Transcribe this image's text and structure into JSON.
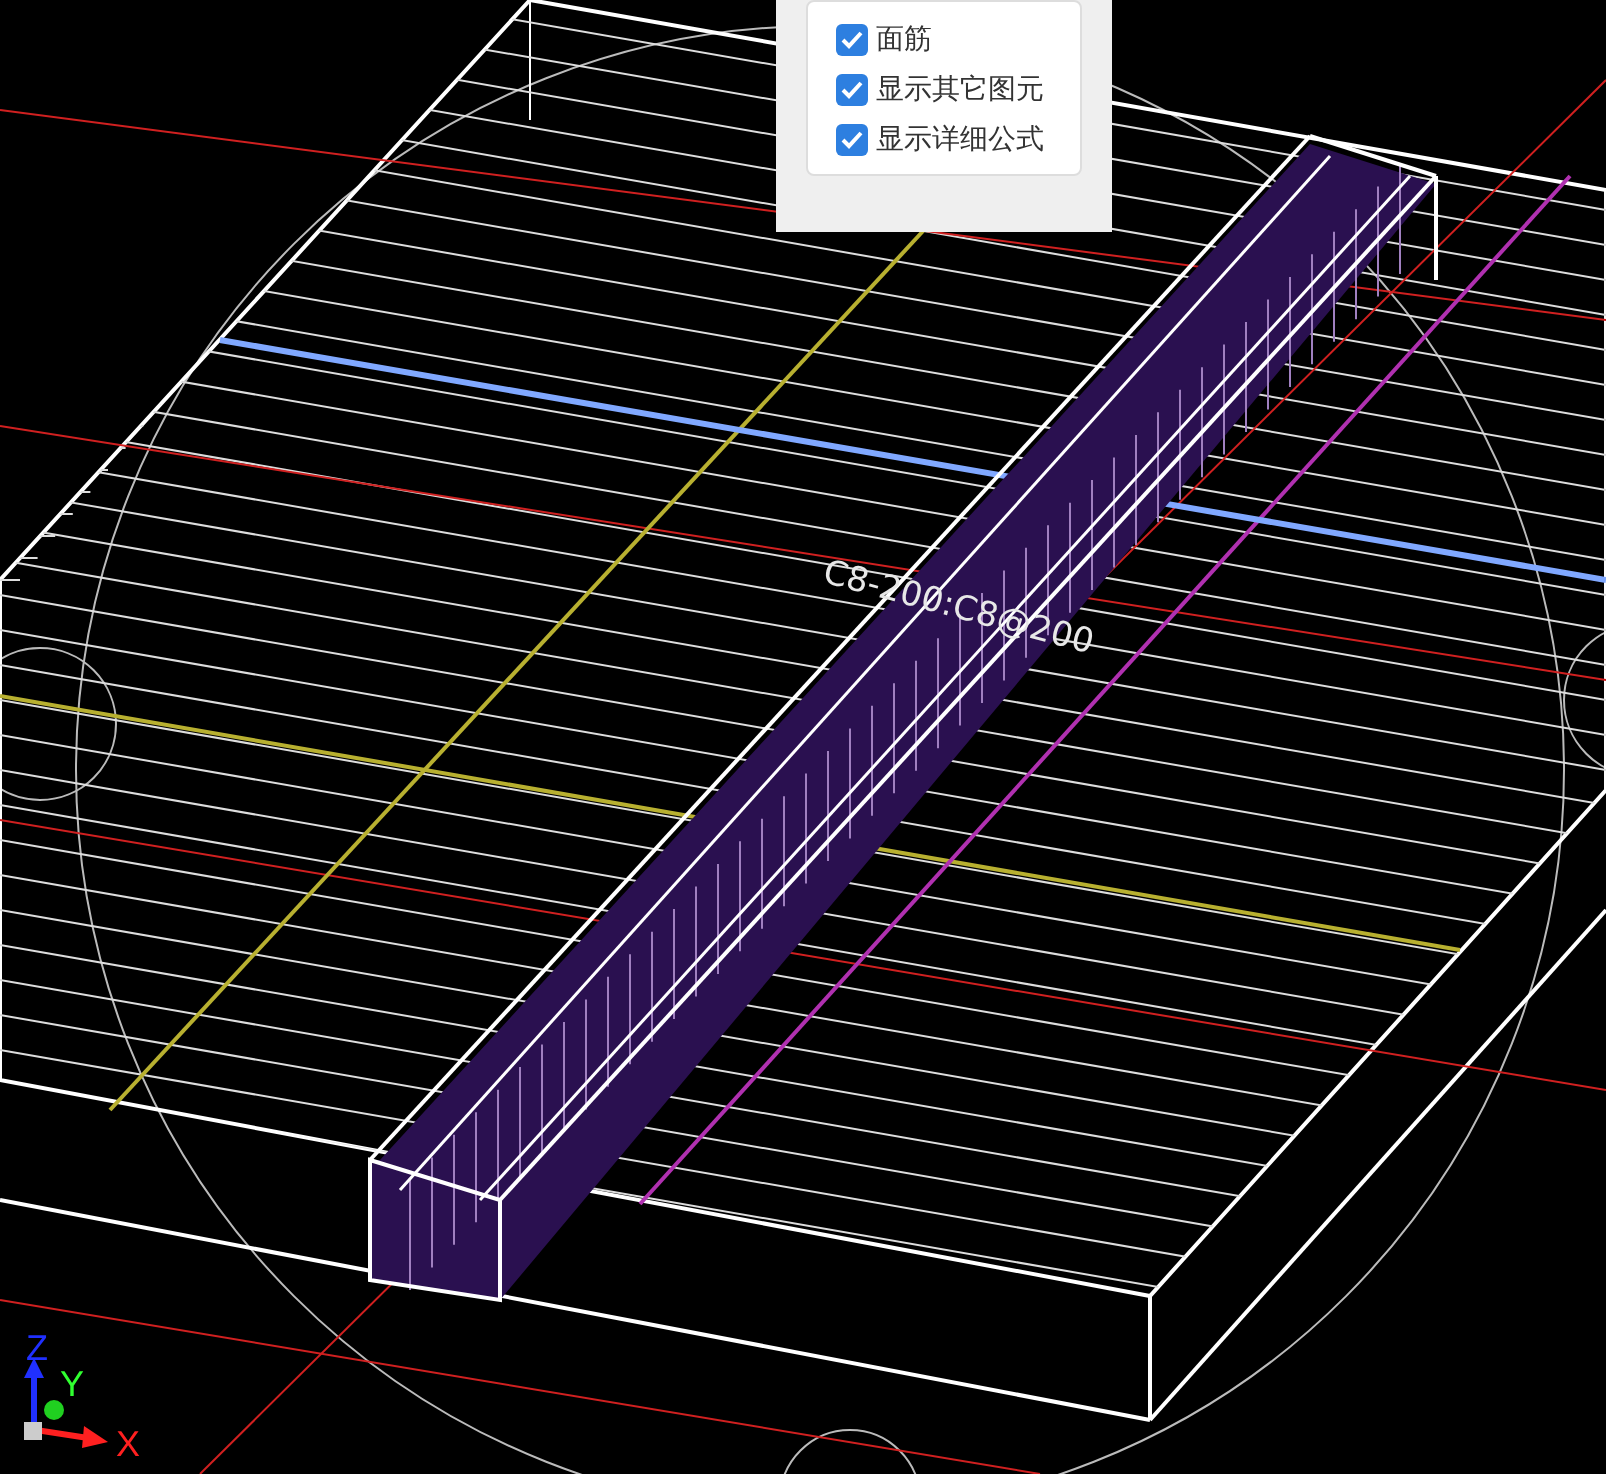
{
  "display_options": [
    {
      "label": "面筋",
      "checked": true
    },
    {
      "label": "显示其它图元",
      "checked": true
    },
    {
      "label": "显示详细公式",
      "checked": true
    }
  ],
  "rebar_label": "C8-200:C8@200",
  "axes": {
    "x": "X",
    "y": "Y",
    "z": "Z"
  }
}
